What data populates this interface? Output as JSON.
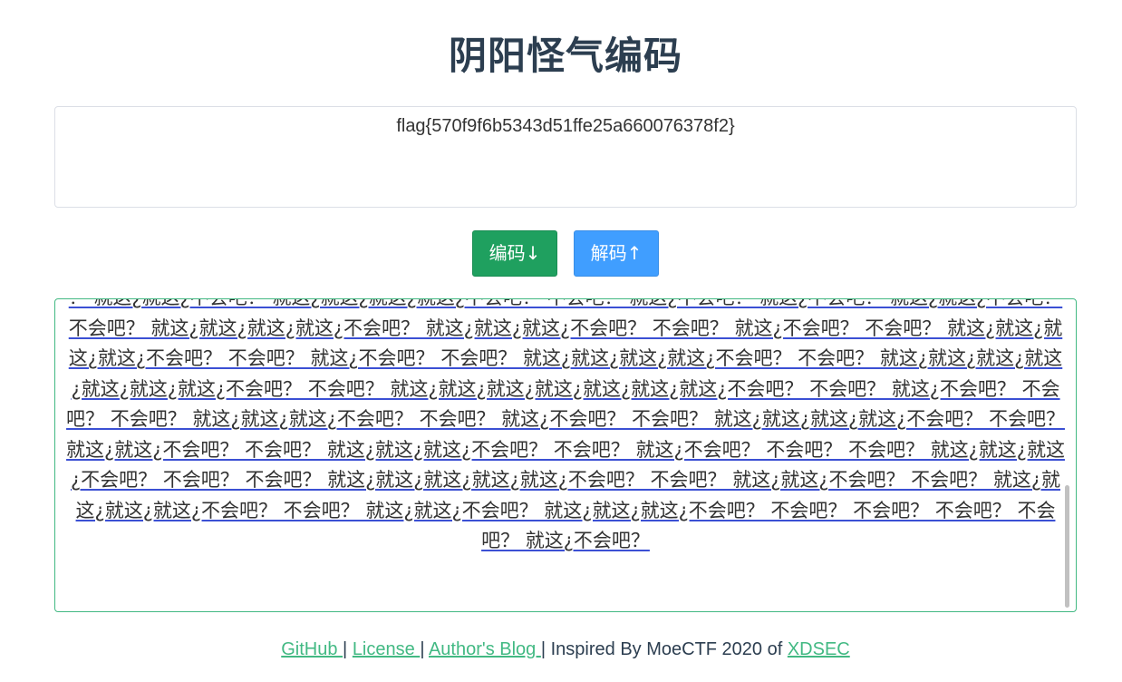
{
  "title": "阴阳怪气编码",
  "input": {
    "value": "flag{570f9f6b5343d51ffe25a660076378f2}"
  },
  "buttons": {
    "encode_label": "编码↓",
    "decode_label": "解码↑"
  },
  "output": {
    "text": "？ 就这¿就这¿不会吧？ 就这¿就这¿就这¿就这¿不会吧？ 不会吧？ 就这¿不会吧？ 就这¿不会吧？ 就这¿就这¿不会吧？ 不会吧？ 就这¿就这¿就这¿就这¿不会吧？ 就这¿就这¿就这¿不会吧？ 不会吧？ 就这¿不会吧？ 不会吧？ 就这¿就这¿就这¿就这¿不会吧？ 不会吧？ 就这¿不会吧？ 不会吧？ 就这¿就这¿就这¿就这¿不会吧？ 不会吧？ 就这¿就这¿就这¿就这¿就这¿就这¿就这¿不会吧？ 不会吧？ 就这¿就这¿就这¿就这¿就这¿就这¿就这¿不会吧？ 不会吧？ 就这¿不会吧？ 不会吧？ 不会吧？ 就这¿就这¿就这¿不会吧？ 不会吧？ 就这¿不会吧？ 不会吧？ 就这¿就这¿就这¿就这¿不会吧？ 不会吧？ 就这¿就这¿不会吧？ 不会吧？ 就这¿就这¿就这¿不会吧？ 不会吧？ 就这¿不会吧？ 不会吧？ 不会吧？ 就这¿就这¿就这¿不会吧？ 不会吧？ 不会吧？ 就这¿就这¿就这¿就这¿就这¿不会吧？ 不会吧？ 就这¿就这¿不会吧？ 不会吧？ 就这¿就这¿就这¿就这¿不会吧？ 不会吧？ 就这¿就这¿不会吧？ 就这¿就这¿就这¿不会吧？ 不会吧？ 不会吧？ 不会吧？ 不会吧？ 就这¿不会吧？"
  },
  "footer": {
    "github": "GitHub ",
    "sep1": " | ",
    "license": "License ",
    "sep2": " | ",
    "blog": "Author's Blog ",
    "inspired": " | Inspired By MoeCTF 2020 of ",
    "xdsec": "XDSEC"
  }
}
